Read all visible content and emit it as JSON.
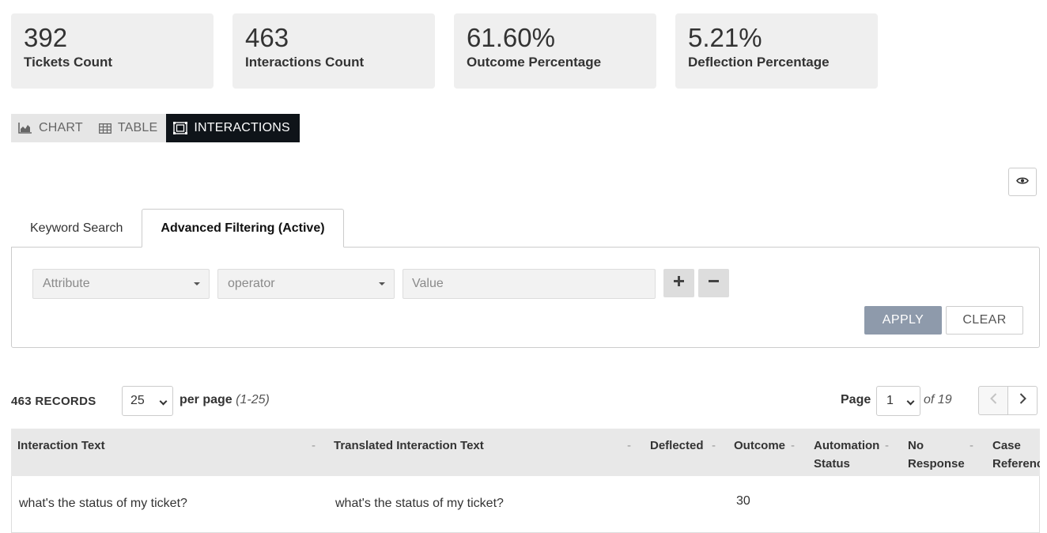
{
  "stats": [
    {
      "value": "392",
      "label": "Tickets Count"
    },
    {
      "value": "463",
      "label": "Interactions Count"
    },
    {
      "value": "61.60%",
      "label": "Outcome Percentage"
    },
    {
      "value": "5.21%",
      "label": "Deflection Percentage"
    }
  ],
  "views": {
    "chart": "CHART",
    "table": "TABLE",
    "interactions": "INTERACTIONS",
    "active": "interactions"
  },
  "tabs": {
    "keyword": "Keyword Search",
    "advanced": "Advanced Filtering (Active)"
  },
  "filter": {
    "attribute_placeholder": "Attribute",
    "operator_placeholder": "operator",
    "value_placeholder": "Value",
    "apply_label": "APPLY",
    "clear_label": "CLEAR"
  },
  "records": {
    "count_label": "463 RECORDS",
    "per_page_value": "25",
    "per_page_label": "per page",
    "range": "(1-25)",
    "page_label": "Page",
    "page_value": "1",
    "of_label": "of 19"
  },
  "table": {
    "columns": [
      "Interaction Text",
      "Translated Interaction Text",
      "Deflected",
      "Outcome",
      "Automation Status",
      "No Response",
      "Case Reference"
    ],
    "sort_marker": "-",
    "rows": [
      {
        "interaction_text": "what's the status of my ticket?",
        "translated_text": "what's the status of my ticket?",
        "deflected": "",
        "outcome": "30",
        "automation_status": "",
        "no_response": "",
        "case_reference": ""
      }
    ]
  }
}
